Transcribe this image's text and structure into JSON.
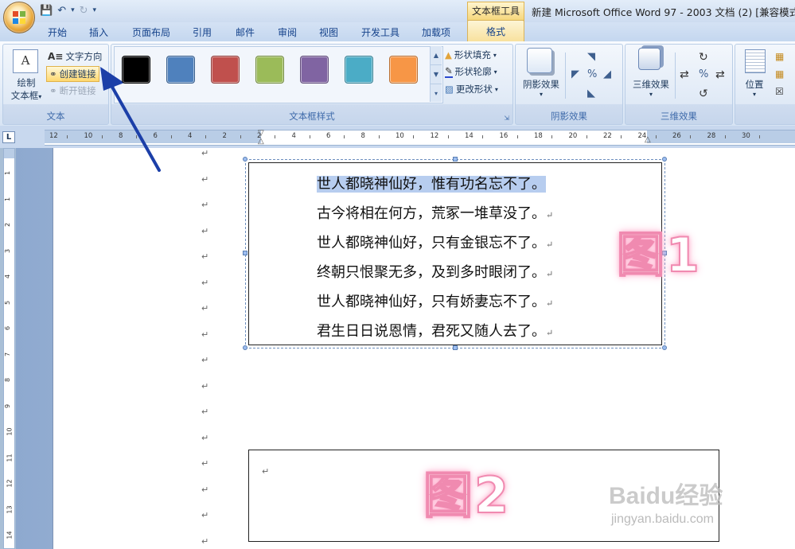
{
  "app": {
    "window_title": "新建 Microsoft Office Word 97 - 2003 文档 (2) [兼容模式]",
    "contextual_tab_label": "文本框工具"
  },
  "quick_access": {
    "save_icon": "save-icon",
    "undo_icon": "undo-icon",
    "redo_icon": "redo-icon",
    "customize_icon": "customize-icon"
  },
  "tabs": [
    "开始",
    "插入",
    "页面布局",
    "引用",
    "邮件",
    "审阅",
    "视图",
    "开发工具",
    "加载项"
  ],
  "active_tab": "格式",
  "ribbon": {
    "text_group": {
      "label": "文本",
      "draw_textbox_line1": "绘制",
      "draw_textbox_line2": "文本框",
      "text_direction": "文字方向",
      "create_link": "创建链接",
      "break_link": "断开链接"
    },
    "textbox_styles_group": {
      "label": "文本框样式",
      "swatches": [
        "#000000",
        "#4f81bd",
        "#c0504d",
        "#9bbb59",
        "#8064a2",
        "#4bacc6",
        "#f79646"
      ],
      "shape_fill": "形状填充",
      "shape_outline": "形状轮廓",
      "change_shape": "更改形状"
    },
    "shadow_group": {
      "label": "阴影效果",
      "shadow_effects": "阴影效果"
    },
    "threed_group": {
      "label": "三维效果",
      "threed_effects": "三维效果"
    },
    "arrange_group": {
      "position": "位置"
    }
  },
  "ruler": {
    "h_numbers": [
      "12",
      "10",
      "8",
      "6",
      "4",
      "2",
      "2",
      "4",
      "6",
      "8",
      "10",
      "12",
      "14",
      "16",
      "18",
      "20",
      "22",
      "24",
      "26",
      "28",
      "30"
    ],
    "v_numbers": [
      "1",
      "1",
      "2",
      "3",
      "4",
      "5",
      "6",
      "7",
      "8",
      "9",
      "10",
      "11",
      "12",
      "13",
      "14"
    ]
  },
  "document": {
    "paragraph_mark": "↵",
    "textbox1_lines": [
      "世人都晓神仙好，惟有功名忘不了。",
      "古今将相在何方，荒冢一堆草没了。",
      "世人都晓神仙好，只有金银忘不了。",
      "终朝只恨聚无多，及到多时眼闭了。",
      "世人都晓神仙好，只有娇妻忘不了。",
      "君生日日说恩情，君死又随人去了。"
    ],
    "figure1_label": "图1",
    "figure2_label": "图2"
  },
  "watermark": {
    "main": "Baidu经验",
    "sub": "jingyan.baidu.com"
  }
}
